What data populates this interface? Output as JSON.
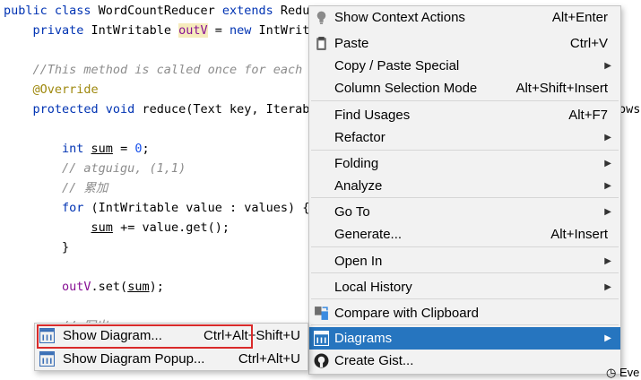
{
  "editor": {
    "lines": [
      {
        "segments": [
          {
            "t": "public class ",
            "c": "kw"
          },
          {
            "t": "WordCountReducer ",
            "c": "cls"
          },
          {
            "t": "extends ",
            "c": "kw"
          },
          {
            "t": "Reduc",
            "c": "cls"
          }
        ]
      },
      {
        "segments": [
          {
            "t": "    private ",
            "c": "kw"
          },
          {
            "t": "IntWritable ",
            "c": "cls"
          },
          {
            "t": "outV",
            "c": "hlv"
          },
          {
            "t": " = ",
            "c": "cls"
          },
          {
            "t": "new ",
            "c": "kw"
          },
          {
            "t": "IntWrita",
            "c": "cls"
          }
        ]
      },
      {
        "segments": []
      },
      {
        "segments": [
          {
            "t": "    //This method is called once for each k",
            "c": "cmt"
          }
        ]
      },
      {
        "segments": [
          {
            "t": "    @Override",
            "c": "ann"
          }
        ]
      },
      {
        "segments": [
          {
            "t": "    protected void ",
            "c": "kw"
          },
          {
            "t": "reduce(Text key, Iterabl",
            "c": "cls"
          }
        ]
      },
      {
        "segments": []
      },
      {
        "segments": [
          {
            "t": "        int ",
            "c": "kw"
          },
          {
            "t": "sum",
            "c": "ul"
          },
          {
            "t": " = ",
            "c": "cls"
          },
          {
            "t": "0",
            "c": "num"
          },
          {
            "t": ";",
            "c": "cls"
          }
        ]
      },
      {
        "segments": [
          {
            "t": "        // atguigu, (1,1)",
            "c": "cmt"
          }
        ]
      },
      {
        "segments": [
          {
            "t": "        // 累加",
            "c": "cmt"
          }
        ]
      },
      {
        "segments": [
          {
            "t": "        for ",
            "c": "kw"
          },
          {
            "t": "(IntWritable value : values) {",
            "c": "cls"
          }
        ]
      },
      {
        "segments": [
          {
            "t": "            ",
            "c": "cls"
          },
          {
            "t": "sum",
            "c": "ul"
          },
          {
            "t": " += value.get();",
            "c": "cls"
          }
        ]
      },
      {
        "segments": [
          {
            "t": "        }",
            "c": "cls"
          }
        ]
      },
      {
        "segments": []
      },
      {
        "segments": [
          {
            "t": "        ",
            "c": "cls"
          },
          {
            "t": "outV",
            "c": "fld"
          },
          {
            "t": ".set(",
            "c": "cls"
          },
          {
            "t": "sum",
            "c": "ul"
          },
          {
            "t": ");",
            "c": "cls"
          }
        ]
      },
      {
        "segments": []
      },
      {
        "segments": [
          {
            "t": "        // 写出",
            "c": "cmt"
          }
        ]
      }
    ],
    "right_fragment": "ows",
    "status_fragment": "Eve"
  },
  "context_menu": {
    "items": [
      {
        "name": "show-context-actions",
        "icon": "bulb-icon",
        "label": "Show Context Actions",
        "shortcut": "Alt+Enter",
        "submenu": false,
        "sep_after": false
      },
      {
        "name": "paste",
        "icon": "clipboard-icon",
        "label": "Paste",
        "shortcut": "Ctrl+V",
        "submenu": false,
        "sep_after": false
      },
      {
        "name": "copy-paste-special",
        "icon": "",
        "label": "Copy / Paste Special",
        "shortcut": "",
        "submenu": true,
        "sep_after": false
      },
      {
        "name": "column-selection-mode",
        "icon": "",
        "label": "Column Selection Mode",
        "shortcut": "Alt+Shift+Insert",
        "submenu": false,
        "sep_after": true
      },
      {
        "name": "find-usages",
        "icon": "",
        "label": "Find Usages",
        "shortcut": "Alt+F7",
        "submenu": false,
        "sep_after": false
      },
      {
        "name": "refactor",
        "icon": "",
        "label": "Refactor",
        "shortcut": "",
        "submenu": true,
        "sep_after": true
      },
      {
        "name": "folding",
        "icon": "",
        "label": "Folding",
        "shortcut": "",
        "submenu": true,
        "sep_after": false
      },
      {
        "name": "analyze",
        "icon": "",
        "label": "Analyze",
        "shortcut": "",
        "submenu": true,
        "sep_after": true
      },
      {
        "name": "go-to",
        "icon": "",
        "label": "Go To",
        "shortcut": "",
        "submenu": true,
        "sep_after": false
      },
      {
        "name": "generate",
        "icon": "",
        "label": "Generate...",
        "shortcut": "Alt+Insert",
        "submenu": false,
        "sep_after": true
      },
      {
        "name": "open-in",
        "icon": "",
        "label": "Open In",
        "shortcut": "",
        "submenu": true,
        "sep_after": true
      },
      {
        "name": "local-history",
        "icon": "",
        "label": "Local History",
        "shortcut": "",
        "submenu": true,
        "sep_after": true
      },
      {
        "name": "compare-with-clipboard",
        "icon": "compare-icon",
        "label": "Compare with Clipboard",
        "shortcut": "",
        "submenu": false,
        "sep_after": true
      },
      {
        "name": "diagrams",
        "icon": "diagram-icon",
        "label": "Diagrams",
        "shortcut": "",
        "submenu": true,
        "sep_after": false,
        "selected": true
      },
      {
        "name": "create-gist",
        "icon": "github-icon",
        "label": "Create Gist...",
        "shortcut": "",
        "submenu": false,
        "sep_after": false
      }
    ]
  },
  "submenu": {
    "items": [
      {
        "name": "show-diagram",
        "icon": "diagram-icon",
        "label": "Show Diagram...",
        "shortcut": "Ctrl+Alt+Shift+U"
      },
      {
        "name": "show-diagram-popup",
        "icon": "diagram-icon",
        "label": "Show Diagram Popup...",
        "shortcut": "Ctrl+Alt+U"
      }
    ]
  },
  "colors": {
    "selection": "#2675bf",
    "highlight_box": "#d92a2a"
  }
}
